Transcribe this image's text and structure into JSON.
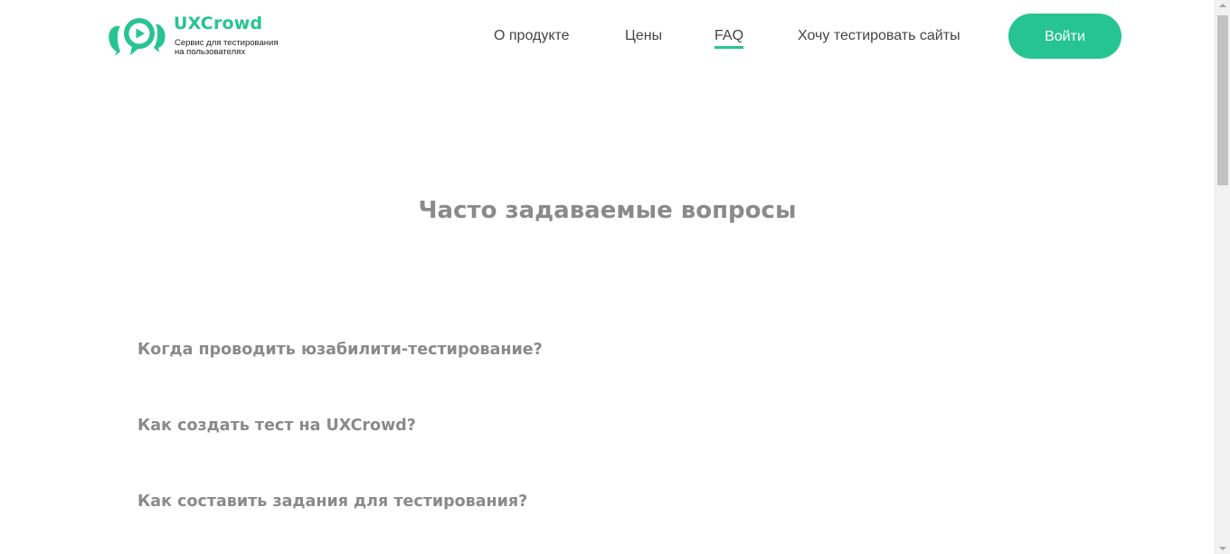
{
  "header": {
    "logo": {
      "name": "UXCrowd",
      "tagline_line1": "Сервис для тестирования",
      "tagline_line2": "на пользователях",
      "brand_color": "#26c491",
      "icon": "speech-bubbles-play-icon"
    },
    "nav": [
      {
        "label": "О продукте",
        "active": false
      },
      {
        "label": "Цены",
        "active": false
      },
      {
        "label": "FAQ",
        "active": true
      },
      {
        "label": "Хочу тестировать сайты",
        "active": false
      }
    ],
    "login_label": "Войти"
  },
  "main": {
    "title": "Часто задаваемые вопросы",
    "faq": [
      {
        "question": "Когда проводить юзабилити-тестирование?"
      },
      {
        "question": "Как создать тест на UXCrowd?"
      },
      {
        "question": "Как составить задания для тестирования?"
      }
    ]
  },
  "colors": {
    "accent": "#26c491",
    "heading_gray": "#8a8a8a",
    "nav_text": "#444444"
  }
}
